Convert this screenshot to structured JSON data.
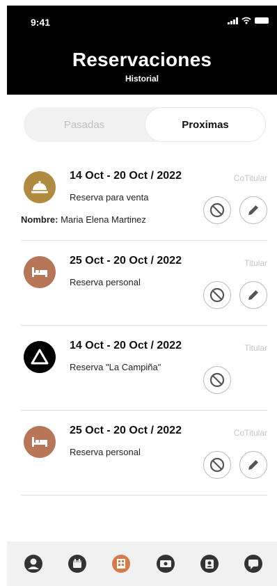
{
  "status_bar": {
    "time": "9:41"
  },
  "header": {
    "title": "Reservaciones",
    "subtitle": "Historial"
  },
  "segmented": {
    "left_label": "Pasadas",
    "right_label": "Proximas",
    "selected": "Proximas"
  },
  "reservations": [
    {
      "date_range": "14 Oct - 20 Oct / 2022",
      "role": "CoTitular",
      "description": "Reserva para venta",
      "owner_label": "Nombre:",
      "owner_name": "Maria Elena Martinez",
      "icon": "bell-service-icon",
      "icon_bg": "#b08a3e",
      "can_edit": true
    },
    {
      "date_range": "25 Oct - 20 Oct / 2022",
      "role": "Titular",
      "description": "Reserva personal",
      "icon": "bed-icon",
      "icon_bg": "#b67657",
      "can_edit": true
    },
    {
      "date_range": "14 Oct - 20 Oct / 2022",
      "role": "Titular",
      "description": "Reserva \"La Campiña\"",
      "icon": "triangle-logo-icon",
      "icon_bg": "#000000",
      "can_edit": false
    },
    {
      "date_range": "25 Oct - 20 Oct / 2022",
      "role": "CoTitular",
      "description": "Reserva personal",
      "icon": "bed-icon",
      "icon_bg": "#b67657",
      "can_edit": true
    }
  ],
  "tabbar": {
    "items": [
      "user-icon",
      "calendar-icon",
      "building-icon",
      "money-icon",
      "contacts-icon",
      "chat-icon"
    ],
    "active_index": 2,
    "colors": {
      "active": "#d97a4a",
      "inactive": "#333333"
    }
  }
}
